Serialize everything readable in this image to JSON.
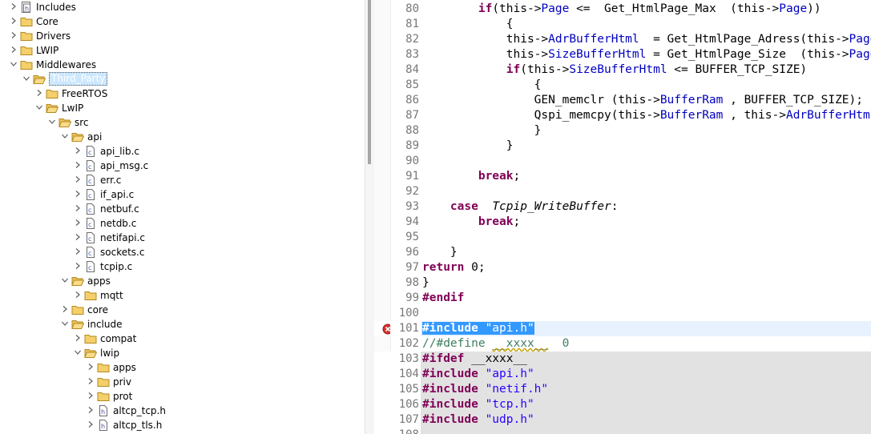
{
  "tree": {
    "rows": [
      {
        "label": "Includes",
        "icon": "includes-icon",
        "toggle": "collapsed",
        "indent": 0
      },
      {
        "label": "Core",
        "icon": "folder-icon",
        "toggle": "collapsed",
        "indent": 0
      },
      {
        "label": "Drivers",
        "icon": "folder-icon",
        "toggle": "collapsed",
        "indent": 0
      },
      {
        "label": "LWIP",
        "icon": "folder-icon",
        "toggle": "collapsed",
        "indent": 0
      },
      {
        "label": "Middlewares",
        "icon": "folder-icon",
        "toggle": "expanded",
        "indent": 0
      },
      {
        "label": "Third_Party",
        "icon": "folder-open-icon",
        "toggle": "expanded",
        "indent": 1,
        "selected": true
      },
      {
        "label": "FreeRTOS",
        "icon": "folder-icon",
        "toggle": "collapsed",
        "indent": 2
      },
      {
        "label": "LwIP",
        "icon": "folder-open-icon",
        "toggle": "expanded",
        "indent": 2
      },
      {
        "label": "src",
        "icon": "folder-open-icon",
        "toggle": "expanded",
        "indent": 3
      },
      {
        "label": "api",
        "icon": "folder-open-icon",
        "toggle": "expanded",
        "indent": 4
      },
      {
        "label": "api_lib.c",
        "icon": "c-file-icon",
        "toggle": "collapsed",
        "indent": 5
      },
      {
        "label": "api_msg.c",
        "icon": "c-file-icon",
        "toggle": "collapsed",
        "indent": 5
      },
      {
        "label": "err.c",
        "icon": "c-file-icon",
        "toggle": "collapsed",
        "indent": 5
      },
      {
        "label": "if_api.c",
        "icon": "c-file-icon",
        "toggle": "collapsed",
        "indent": 5
      },
      {
        "label": "netbuf.c",
        "icon": "c-file-icon",
        "toggle": "collapsed",
        "indent": 5
      },
      {
        "label": "netdb.c",
        "icon": "c-file-icon",
        "toggle": "collapsed",
        "indent": 5
      },
      {
        "label": "netifapi.c",
        "icon": "c-file-icon",
        "toggle": "collapsed",
        "indent": 5
      },
      {
        "label": "sockets.c",
        "icon": "c-file-icon",
        "toggle": "collapsed",
        "indent": 5
      },
      {
        "label": "tcpip.c",
        "icon": "c-file-icon",
        "toggle": "collapsed",
        "indent": 5
      },
      {
        "label": "apps",
        "icon": "folder-open-icon",
        "toggle": "expanded",
        "indent": 4
      },
      {
        "label": "mqtt",
        "icon": "folder-icon",
        "toggle": "collapsed",
        "indent": 5
      },
      {
        "label": "core",
        "icon": "folder-icon",
        "toggle": "collapsed",
        "indent": 4
      },
      {
        "label": "include",
        "icon": "folder-open-icon",
        "toggle": "expanded",
        "indent": 4
      },
      {
        "label": "compat",
        "icon": "folder-icon",
        "toggle": "collapsed",
        "indent": 5
      },
      {
        "label": "lwip",
        "icon": "folder-open-icon",
        "toggle": "expanded",
        "indent": 5
      },
      {
        "label": "apps",
        "icon": "folder-icon",
        "toggle": "collapsed",
        "indent": 6
      },
      {
        "label": "priv",
        "icon": "folder-icon",
        "toggle": "collapsed",
        "indent": 6
      },
      {
        "label": "prot",
        "icon": "folder-icon",
        "toggle": "collapsed",
        "indent": 6
      },
      {
        "label": "altcp_tcp.h",
        "icon": "h-file-icon",
        "toggle": "collapsed",
        "indent": 6
      },
      {
        "label": "altcp_tls.h",
        "icon": "h-file-icon",
        "toggle": "collapsed",
        "indent": 6
      }
    ]
  },
  "editor": {
    "lines": [
      {
        "n": "80",
        "state": "normal",
        "tokens": [
          [
            "        ",
            ""
          ],
          [
            "if",
            "kw"
          ],
          [
            "(this->",
            ""
          ],
          [
            "Page",
            "fld"
          ],
          [
            " <=  Get_HtmlPage_Max  (this->",
            ""
          ],
          [
            "Page",
            "fld"
          ],
          [
            "))",
            ""
          ]
        ]
      },
      {
        "n": "81",
        "state": "normal",
        "tokens": [
          [
            "            {",
            ""
          ]
        ]
      },
      {
        "n": "82",
        "state": "normal",
        "tokens": [
          [
            "            this->",
            ""
          ],
          [
            "AdrBufferHtml",
            "fld"
          ],
          [
            "  = Get_HtmlPage_Adress(this->",
            ""
          ],
          [
            "Page",
            "fld"
          ],
          [
            ");",
            ""
          ]
        ]
      },
      {
        "n": "83",
        "state": "normal",
        "tokens": [
          [
            "            this->",
            ""
          ],
          [
            "SizeBufferHtml",
            "fld"
          ],
          [
            " = Get_HtmlPage_Size  (this->",
            ""
          ],
          [
            "Page",
            "fld"
          ],
          [
            ");",
            ""
          ]
        ]
      },
      {
        "n": "84",
        "state": "normal",
        "tokens": [
          [
            "            ",
            ""
          ],
          [
            "if",
            "kw"
          ],
          [
            "(this->",
            ""
          ],
          [
            "SizeBufferHtml",
            "fld"
          ],
          [
            " <= BUFFER_TCP_SIZE)",
            ""
          ]
        ]
      },
      {
        "n": "85",
        "state": "normal",
        "tokens": [
          [
            "                {",
            ""
          ]
        ]
      },
      {
        "n": "86",
        "state": "normal",
        "tokens": [
          [
            "                GEN_memclr (this->",
            ""
          ],
          [
            "BufferRam",
            "fld"
          ],
          [
            " , BUFFER_TCP_SIZE);",
            ""
          ]
        ]
      },
      {
        "n": "87",
        "state": "normal",
        "tokens": [
          [
            "                Qspi_memcpy(this->",
            ""
          ],
          [
            "BufferRam",
            "fld"
          ],
          [
            " , this->",
            ""
          ],
          [
            "AdrBufferHtml",
            "fld"
          ],
          [
            " , this->",
            ""
          ],
          [
            "SizeBufferHtml",
            "fld"
          ],
          [
            ");",
            ""
          ]
        ]
      },
      {
        "n": "88",
        "state": "normal",
        "tokens": [
          [
            "                }",
            ""
          ]
        ]
      },
      {
        "n": "89",
        "state": "normal",
        "tokens": [
          [
            "            }",
            ""
          ]
        ]
      },
      {
        "n": "90",
        "state": "normal",
        "tokens": []
      },
      {
        "n": "91",
        "state": "normal",
        "tokens": [
          [
            "        ",
            ""
          ],
          [
            "break",
            "kw"
          ],
          [
            ";",
            ""
          ]
        ]
      },
      {
        "n": "92",
        "state": "normal",
        "tokens": []
      },
      {
        "n": "93",
        "state": "normal",
        "tokens": [
          [
            "    ",
            ""
          ],
          [
            "case",
            "kw"
          ],
          [
            "  ",
            ""
          ],
          [
            "Tcpip_WriteBuffer",
            "it"
          ],
          [
            ":",
            ""
          ]
        ]
      },
      {
        "n": "94",
        "state": "normal",
        "tokens": [
          [
            "        ",
            ""
          ],
          [
            "break",
            "kw"
          ],
          [
            ";",
            ""
          ]
        ]
      },
      {
        "n": "95",
        "state": "normal",
        "tokens": []
      },
      {
        "n": "96",
        "state": "normal",
        "tokens": [
          [
            "    }",
            ""
          ]
        ]
      },
      {
        "n": "97",
        "state": "normal",
        "tokens": [
          [
            "return",
            "kw"
          ],
          [
            " 0;",
            ""
          ]
        ]
      },
      {
        "n": "98",
        "state": "normal",
        "tokens": [
          [
            "}",
            ""
          ]
        ]
      },
      {
        "n": "99",
        "state": "normal",
        "tokens": [
          [
            "#endif",
            "kw"
          ]
        ]
      },
      {
        "n": "100",
        "state": "normal",
        "tokens": []
      },
      {
        "n": "101",
        "state": "current",
        "error": true,
        "tokens": [
          [
            "#include",
            "kw sel"
          ],
          [
            " ",
            "sel"
          ],
          [
            "\"api.h\"",
            "str sel"
          ]
        ]
      },
      {
        "n": "102",
        "state": "normal",
        "tokens": [
          [
            "//#define ",
            "cmt"
          ],
          [
            "__xxxx__",
            "cmt warn"
          ],
          [
            "  0",
            "cmt"
          ]
        ]
      },
      {
        "n": "103",
        "state": "inactive",
        "tokens": [
          [
            "#ifdef",
            "kw"
          ],
          [
            " __xxxx__",
            ""
          ]
        ]
      },
      {
        "n": "104",
        "state": "inactive",
        "tokens": [
          [
            "#include",
            "kw"
          ],
          [
            " ",
            ""
          ],
          [
            "\"api.h\"",
            "str"
          ]
        ]
      },
      {
        "n": "105",
        "state": "inactive",
        "tokens": [
          [
            "#include",
            "kw"
          ],
          [
            " ",
            ""
          ],
          [
            "\"netif.h\"",
            "str"
          ]
        ]
      },
      {
        "n": "106",
        "state": "inactive",
        "tokens": [
          [
            "#include",
            "kw"
          ],
          [
            " ",
            ""
          ],
          [
            "\"tcp.h\"",
            "str"
          ]
        ]
      },
      {
        "n": "107",
        "state": "inactive",
        "tokens": [
          [
            "#include",
            "kw"
          ],
          [
            " ",
            ""
          ],
          [
            "\"udp.h\"",
            "str"
          ]
        ]
      },
      {
        "n": "108",
        "state": "inactive",
        "tokens": []
      }
    ]
  },
  "colors": {
    "keyword": "#7f0055",
    "field": "#0000c0",
    "string": "#2a00ff",
    "comment": "#3f7f5f",
    "selection": "#3399ff",
    "inactive_code": "#e2e2e2",
    "tree_selection": "#cce8ff"
  }
}
